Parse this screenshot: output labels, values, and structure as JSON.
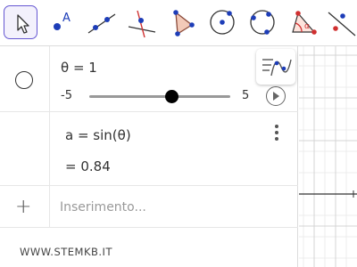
{
  "toolbar": {
    "tools": [
      {
        "name": "move-tool",
        "selected": true
      },
      {
        "name": "point-tool"
      },
      {
        "name": "line-tool"
      },
      {
        "name": "perpendicular-line-tool"
      },
      {
        "name": "polygon-tool"
      },
      {
        "name": "circle-center-point-tool"
      },
      {
        "name": "circle-three-points-tool"
      },
      {
        "name": "angle-tool"
      },
      {
        "name": "reflect-tool"
      }
    ],
    "point_label": "A",
    "angle_label": "α",
    "accent_color": "#6557d2"
  },
  "algebra": {
    "slider": {
      "expression": "θ = 1",
      "min": "-5",
      "max": "5",
      "value": 1
    },
    "function": {
      "definition": "a = sin(θ)",
      "result": "= 0.84"
    },
    "input": {
      "placeholder": "Inserimento..."
    }
  },
  "footer": {
    "link": "WWW.STEMKB.IT"
  }
}
